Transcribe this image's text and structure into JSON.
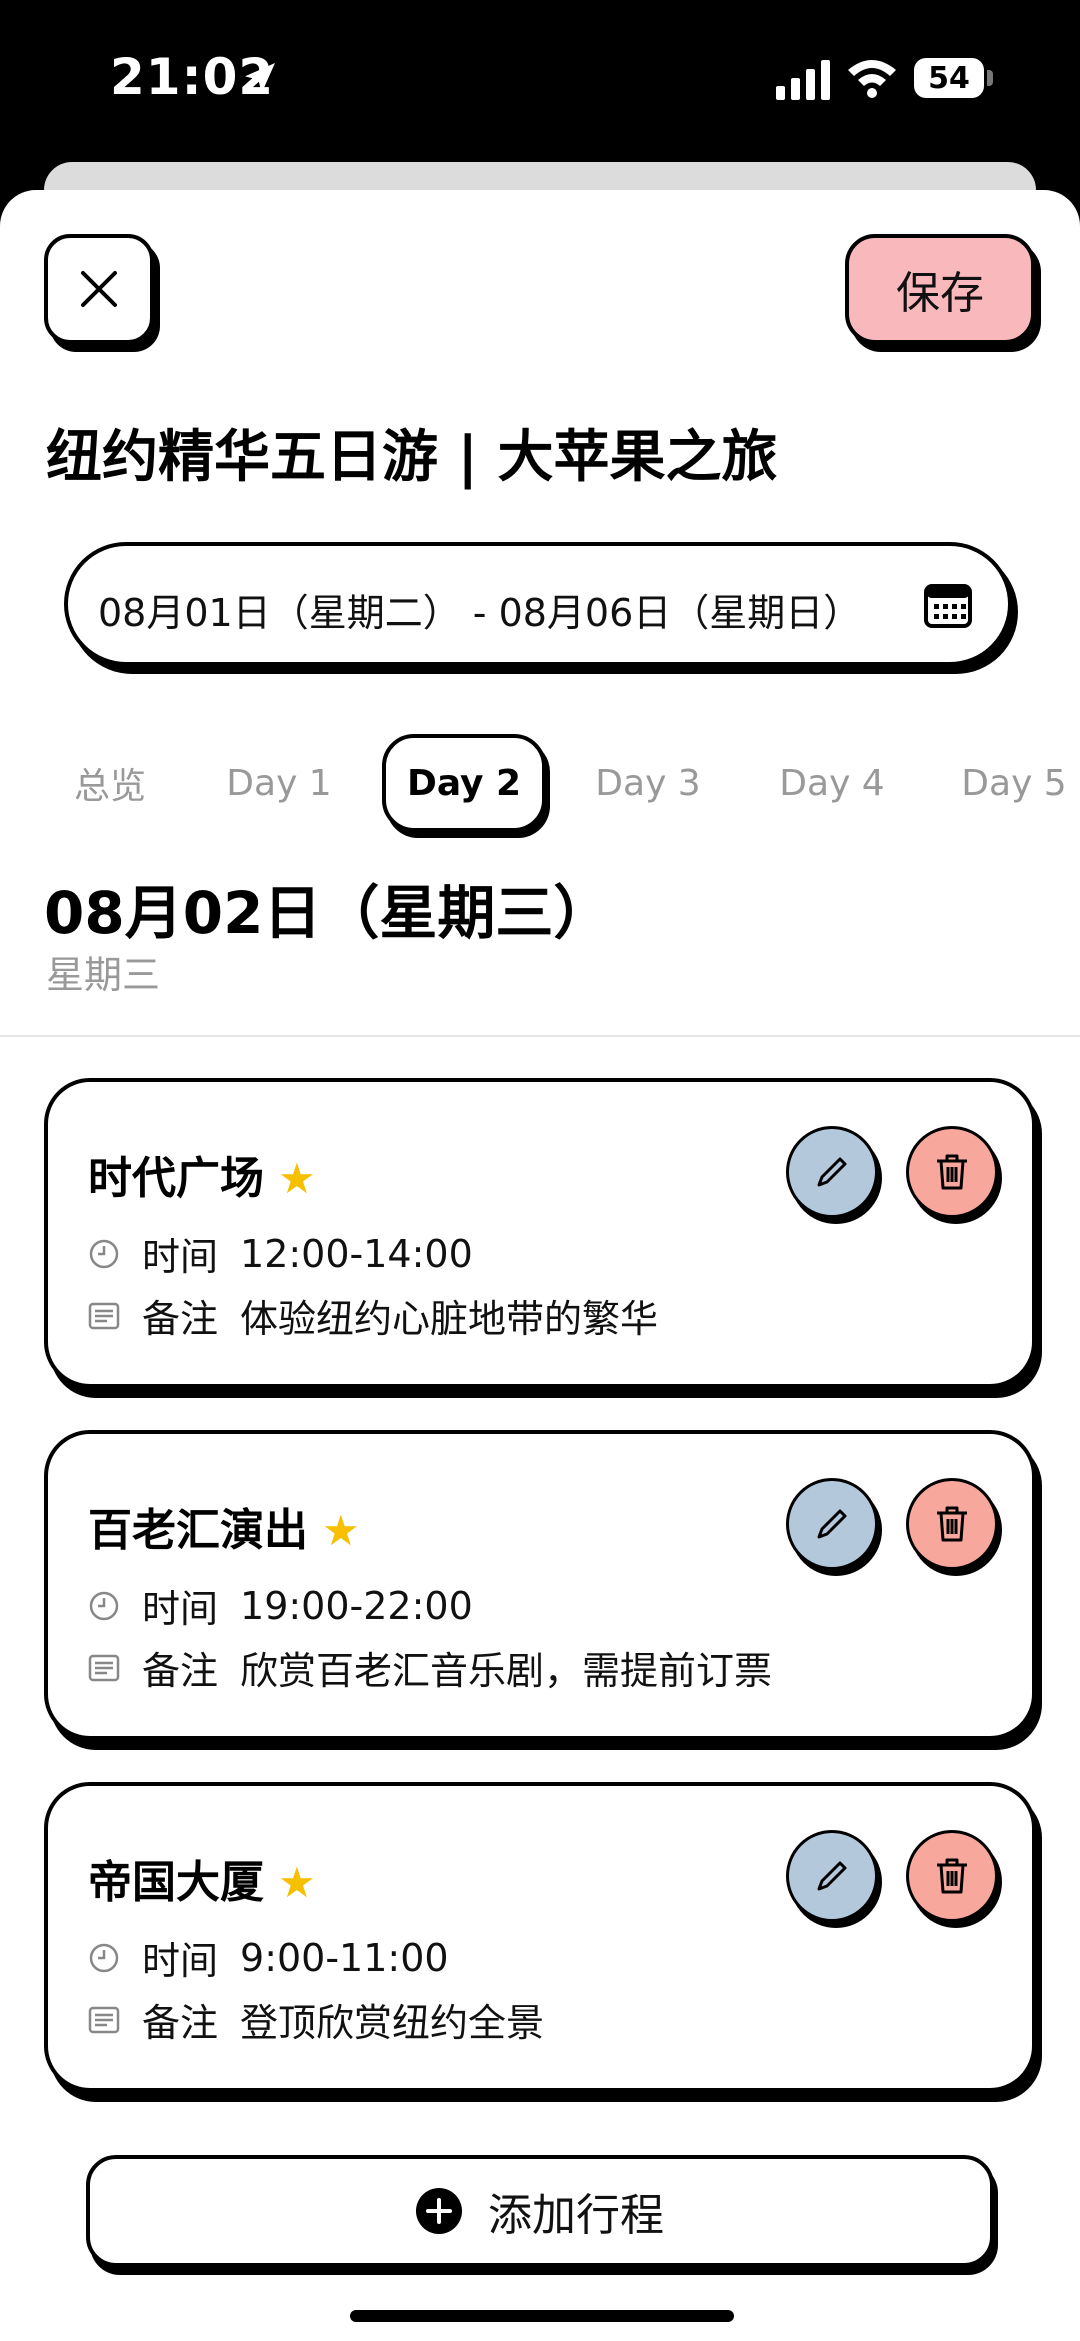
{
  "status_bar": {
    "time": "21:02",
    "battery": "54"
  },
  "header": {
    "save_label": "保存",
    "trip_title": "纽约精华五日游 | 大苹果之旅",
    "date_range": "08月01日（星期二） - 08月06日（星期日）"
  },
  "tabs": [
    {
      "label": "总览",
      "active": false
    },
    {
      "label": "Day 1",
      "active": false
    },
    {
      "label": "Day 2",
      "active": true
    },
    {
      "label": "Day 3",
      "active": false
    },
    {
      "label": "Day 4",
      "active": false
    },
    {
      "label": "Day 5",
      "active": false
    }
  ],
  "day": {
    "title": "08月02日（星期三）",
    "weekday": "星期三"
  },
  "labels": {
    "time": "时间",
    "note": "备注"
  },
  "itinerary": [
    {
      "name": "时代广场",
      "starred": true,
      "time": "12:00-14:00",
      "note": "体验纽约心脏地带的繁华"
    },
    {
      "name": "百老汇演出",
      "starred": true,
      "time": "19:00-22:00",
      "note": "欣赏百老汇音乐剧，需提前订票"
    },
    {
      "name": "帝国大厦",
      "starred": true,
      "time": "9:00-11:00",
      "note": "登顶欣赏纽约全景"
    }
  ],
  "add_label": "添加行程",
  "colors": {
    "save_bg": "#f8b8bc",
    "edit_bg": "#b3c9db",
    "delete_bg": "#f7a79b",
    "star": "#f6c000"
  }
}
